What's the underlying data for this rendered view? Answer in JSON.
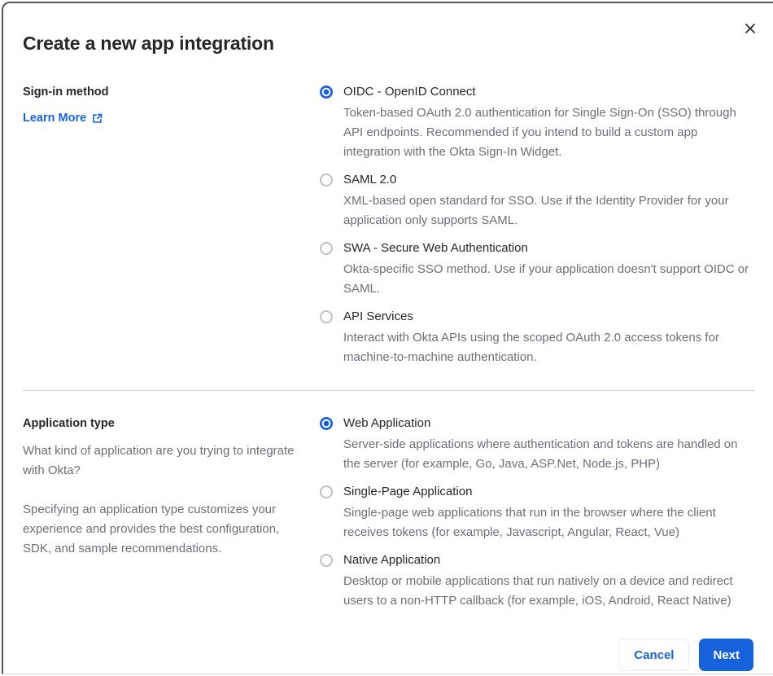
{
  "modal": {
    "title": "Create a new app integration"
  },
  "signin_section": {
    "label": "Sign-in method",
    "learn_more_label": "Learn More",
    "options": [
      {
        "label": "OIDC - OpenID Connect",
        "description": "Token-based OAuth 2.0 authentication for Single Sign-On (SSO) through API endpoints. Recommended if you intend to build a custom app integration with the Okta Sign-In Widget.",
        "selected": true
      },
      {
        "label": "SAML 2.0",
        "description": "XML-based open standard for SSO. Use if the Identity Provider for your application only supports SAML.",
        "selected": false
      },
      {
        "label": "SWA - Secure Web Authentication",
        "description": "Okta-specific SSO method. Use if your application doesn't support OIDC or SAML.",
        "selected": false
      },
      {
        "label": "API Services",
        "description": "Interact with Okta APIs using the scoped OAuth 2.0 access tokens for machine-to-machine authentication.",
        "selected": false
      }
    ]
  },
  "apptype_section": {
    "label": "Application type",
    "description1": "What kind of application are you trying to integrate with Okta?",
    "description2": "Specifying an application type customizes your experience and provides the best configuration, SDK, and sample recommendations.",
    "options": [
      {
        "label": "Web Application",
        "description": "Server-side applications where authentication and tokens are handled on the server (for example, Go, Java, ASP.Net, Node.js, PHP)",
        "selected": true
      },
      {
        "label": "Single-Page Application",
        "description": "Single-page web applications that run in the browser where the client receives tokens (for example, Javascript, Angular, React, Vue)",
        "selected": false
      },
      {
        "label": "Native Application",
        "description": "Desktop or mobile applications that run natively on a device and redirect users to a non-HTTP callback (for example, iOS, Android, React Native)",
        "selected": false
      }
    ]
  },
  "footer": {
    "cancel_label": "Cancel",
    "next_label": "Next"
  },
  "colors": {
    "primary_blue": "#1662dd",
    "text_dark": "#26262b",
    "text_gray": "#6e6e78",
    "divider": "#cfcfd4",
    "modal_border": "#55565c"
  }
}
